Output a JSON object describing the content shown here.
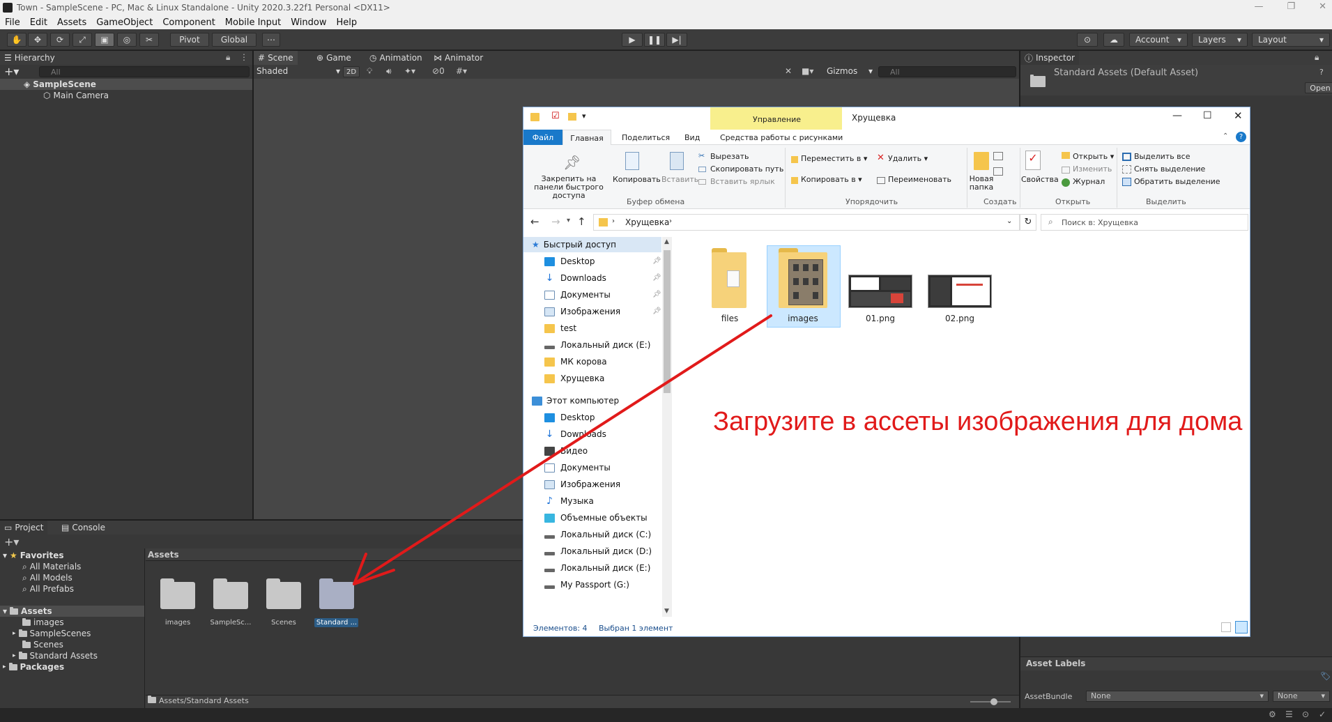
{
  "window_title": "Town - SampleScene - PC, Mac & Linux Standalone - Unity 2020.3.22f1 Personal <DX11>",
  "menu": [
    "File",
    "Edit",
    "Assets",
    "GameObject",
    "Component",
    "Mobile Input",
    "Window",
    "Help"
  ],
  "toolbar": {
    "pivot": "Pivot",
    "global": "Global",
    "account": "Account",
    "layers": "Layers",
    "layout": "Layout"
  },
  "hierarchy": {
    "tab": "Hierarchy",
    "search_placeholder": "All",
    "scene": "SampleScene",
    "items": [
      "Main Camera"
    ]
  },
  "scene_tabs": [
    "Scene",
    "Game",
    "Animation",
    "Animator"
  ],
  "scene_bar": {
    "shading": "Shaded",
    "mode_2d": "2D",
    "gizmos": "Gizmos",
    "search_placeholder": "All",
    "hidden_count": "0"
  },
  "inspector": {
    "tab": "Inspector",
    "title": "Standard Assets (Default Asset)",
    "open": "Open",
    "asset_labels": "Asset Labels",
    "asset_bundle_label": "AssetBundle",
    "bundle_value": "None",
    "variant_value": "None"
  },
  "project": {
    "tabs": [
      "Project",
      "Console"
    ],
    "favorites_label": "Favorites",
    "favorites": [
      "All Materials",
      "All Models",
      "All Prefabs"
    ],
    "assets_label": "Assets",
    "asset_tree": [
      "images",
      "SampleScenes",
      "Scenes",
      "Standard Assets"
    ],
    "packages_label": "Packages",
    "breadcrumb": "Assets",
    "grid": [
      "images",
      "SampleSc...",
      "Scenes",
      "Standard ..."
    ],
    "footer_path": "Assets/Standard Assets"
  },
  "explorer": {
    "title": "Хрущевка",
    "context_tab": "Управление",
    "ribbon_tabs": [
      "Файл",
      "Главная",
      "Поделиться",
      "Вид",
      "Средства работы с рисунками"
    ],
    "clipboard": {
      "pin": "Закрепить на панели быстрого доступа",
      "copy": "Копировать",
      "paste": "Вставить",
      "cut": "Вырезать",
      "copy_path": "Скопировать путь",
      "paste_shortcut": "Вставить ярлык",
      "group": "Буфер обмена"
    },
    "organize": {
      "move": "Переместить в",
      "copy_to": "Копировать в",
      "delete": "Удалить",
      "rename": "Переименовать",
      "group": "Упорядочить"
    },
    "create": {
      "new_folder": "Новая папка",
      "group": "Создать"
    },
    "open_grp": {
      "properties": "Свойства",
      "open": "Открыть",
      "edit": "Изменить",
      "history": "Журнал",
      "group": "Открыть"
    },
    "select": {
      "select_all": "Выделить все",
      "select_none": "Снять выделение",
      "invert": "Обратить выделение",
      "group": "Выделить"
    },
    "address": "Хрущевка",
    "search_placeholder": "Поиск в: Хрущевка",
    "nav": [
      {
        "label": "Быстрый доступ",
        "indent": 0,
        "pin": false
      },
      {
        "label": "Desktop",
        "indent": 1,
        "pin": true
      },
      {
        "label": "Downloads",
        "indent": 1,
        "pin": true
      },
      {
        "label": "Документы",
        "indent": 1,
        "pin": true
      },
      {
        "label": "Изображения",
        "indent": 1,
        "pin": true
      },
      {
        "label": "test",
        "indent": 1,
        "pin": false
      },
      {
        "label": "Локальный диск (E:)",
        "indent": 1,
        "pin": false
      },
      {
        "label": "МК корова",
        "indent": 1,
        "pin": false
      },
      {
        "label": "Хрущевка",
        "indent": 1,
        "pin": false
      },
      {
        "label": "Этот компьютер",
        "indent": 0,
        "pin": false
      },
      {
        "label": "Desktop",
        "indent": 1,
        "pin": false
      },
      {
        "label": "Downloads",
        "indent": 1,
        "pin": false
      },
      {
        "label": "Видео",
        "indent": 1,
        "pin": false
      },
      {
        "label": "Документы",
        "indent": 1,
        "pin": false
      },
      {
        "label": "Изображения",
        "indent": 1,
        "pin": false
      },
      {
        "label": "Музыка",
        "indent": 1,
        "pin": false
      },
      {
        "label": "Объемные объекты",
        "indent": 1,
        "pin": false
      },
      {
        "label": "Локальный диск (C:)",
        "indent": 1,
        "pin": false
      },
      {
        "label": "Локальный диск (D:)",
        "indent": 1,
        "pin": false
      },
      {
        "label": "Локальный диск (E:)",
        "indent": 1,
        "pin": false
      },
      {
        "label": "My Passport (G:)",
        "indent": 1,
        "pin": false
      }
    ],
    "files": [
      "files",
      "images",
      "01.png",
      "02.png"
    ],
    "status_count": "Элементов: 4",
    "status_selected": "Выбран 1 элемент"
  },
  "annotation": "Загрузите в ассеты изображения для дома",
  "colors": {
    "unity_panel": "#383838",
    "unity_toolbar": "#3c3c3c",
    "selection": "#2c5d87",
    "explorer_accent": "#1979ca",
    "annotation": "#e11a1a"
  }
}
